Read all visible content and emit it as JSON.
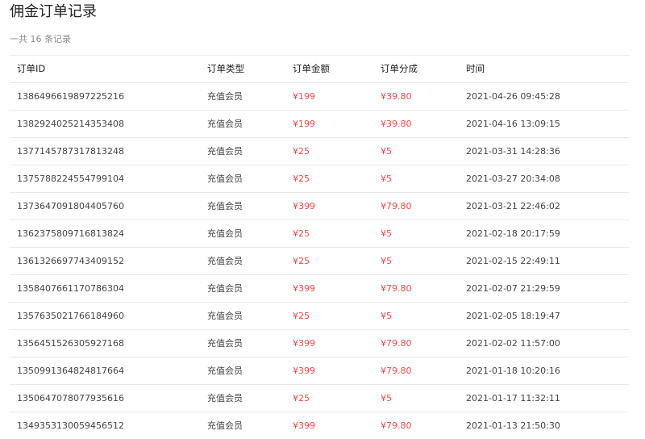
{
  "page": {
    "title": "佣金订单记录",
    "subtitle": "一共 16 条记录"
  },
  "table": {
    "headers": {
      "id": "订单ID",
      "type": "订单类型",
      "amount": "订单金额",
      "share": "订单分成",
      "time": "时间"
    },
    "rows": [
      {
        "id": "1386496619897225216",
        "type": "充值会员",
        "amount": "¥199",
        "share": "¥39.80",
        "time": "2021-04-26 09:45:28"
      },
      {
        "id": "1382924025214353408",
        "type": "充值会员",
        "amount": "¥199",
        "share": "¥39.80",
        "time": "2021-04-16 13:09:15"
      },
      {
        "id": "1377145787317813248",
        "type": "充值会员",
        "amount": "¥25",
        "share": "¥5",
        "time": "2021-03-31 14:28:36"
      },
      {
        "id": "1375788224554799104",
        "type": "充值会员",
        "amount": "¥25",
        "share": "¥5",
        "time": "2021-03-27 20:34:08"
      },
      {
        "id": "1373647091804405760",
        "type": "充值会员",
        "amount": "¥399",
        "share": "¥79.80",
        "time": "2021-03-21 22:46:02"
      },
      {
        "id": "1362375809716813824",
        "type": "充值会员",
        "amount": "¥25",
        "share": "¥5",
        "time": "2021-02-18 20:17:59"
      },
      {
        "id": "1361326697743409152",
        "type": "充值会员",
        "amount": "¥25",
        "share": "¥5",
        "time": "2021-02-15 22:49:11"
      },
      {
        "id": "1358407661170786304",
        "type": "充值会员",
        "amount": "¥399",
        "share": "¥79.80",
        "time": "2021-02-07 21:29:59"
      },
      {
        "id": "1357635021766184960",
        "type": "充值会员",
        "amount": "¥25",
        "share": "¥5",
        "time": "2021-02-05 18:19:47"
      },
      {
        "id": "1356451526305927168",
        "type": "充值会员",
        "amount": "¥399",
        "share": "¥79.80",
        "time": "2021-02-02 11:57:00"
      },
      {
        "id": "1350991364824817664",
        "type": "充值会员",
        "amount": "¥399",
        "share": "¥79.80",
        "time": "2021-01-18 10:20:16"
      },
      {
        "id": "1350647078077935616",
        "type": "充值会员",
        "amount": "¥25",
        "share": "¥5",
        "time": "2021-01-17 11:32:11"
      },
      {
        "id": "1349353130059456512",
        "type": "充值会员",
        "amount": "¥399",
        "share": "¥79.80",
        "time": "2021-01-13 21:50:30"
      }
    ]
  },
  "colors": {
    "money": "#e34d4d",
    "divider": "#e8e8e8",
    "text": "#333333",
    "muted": "#8a8a8a"
  }
}
